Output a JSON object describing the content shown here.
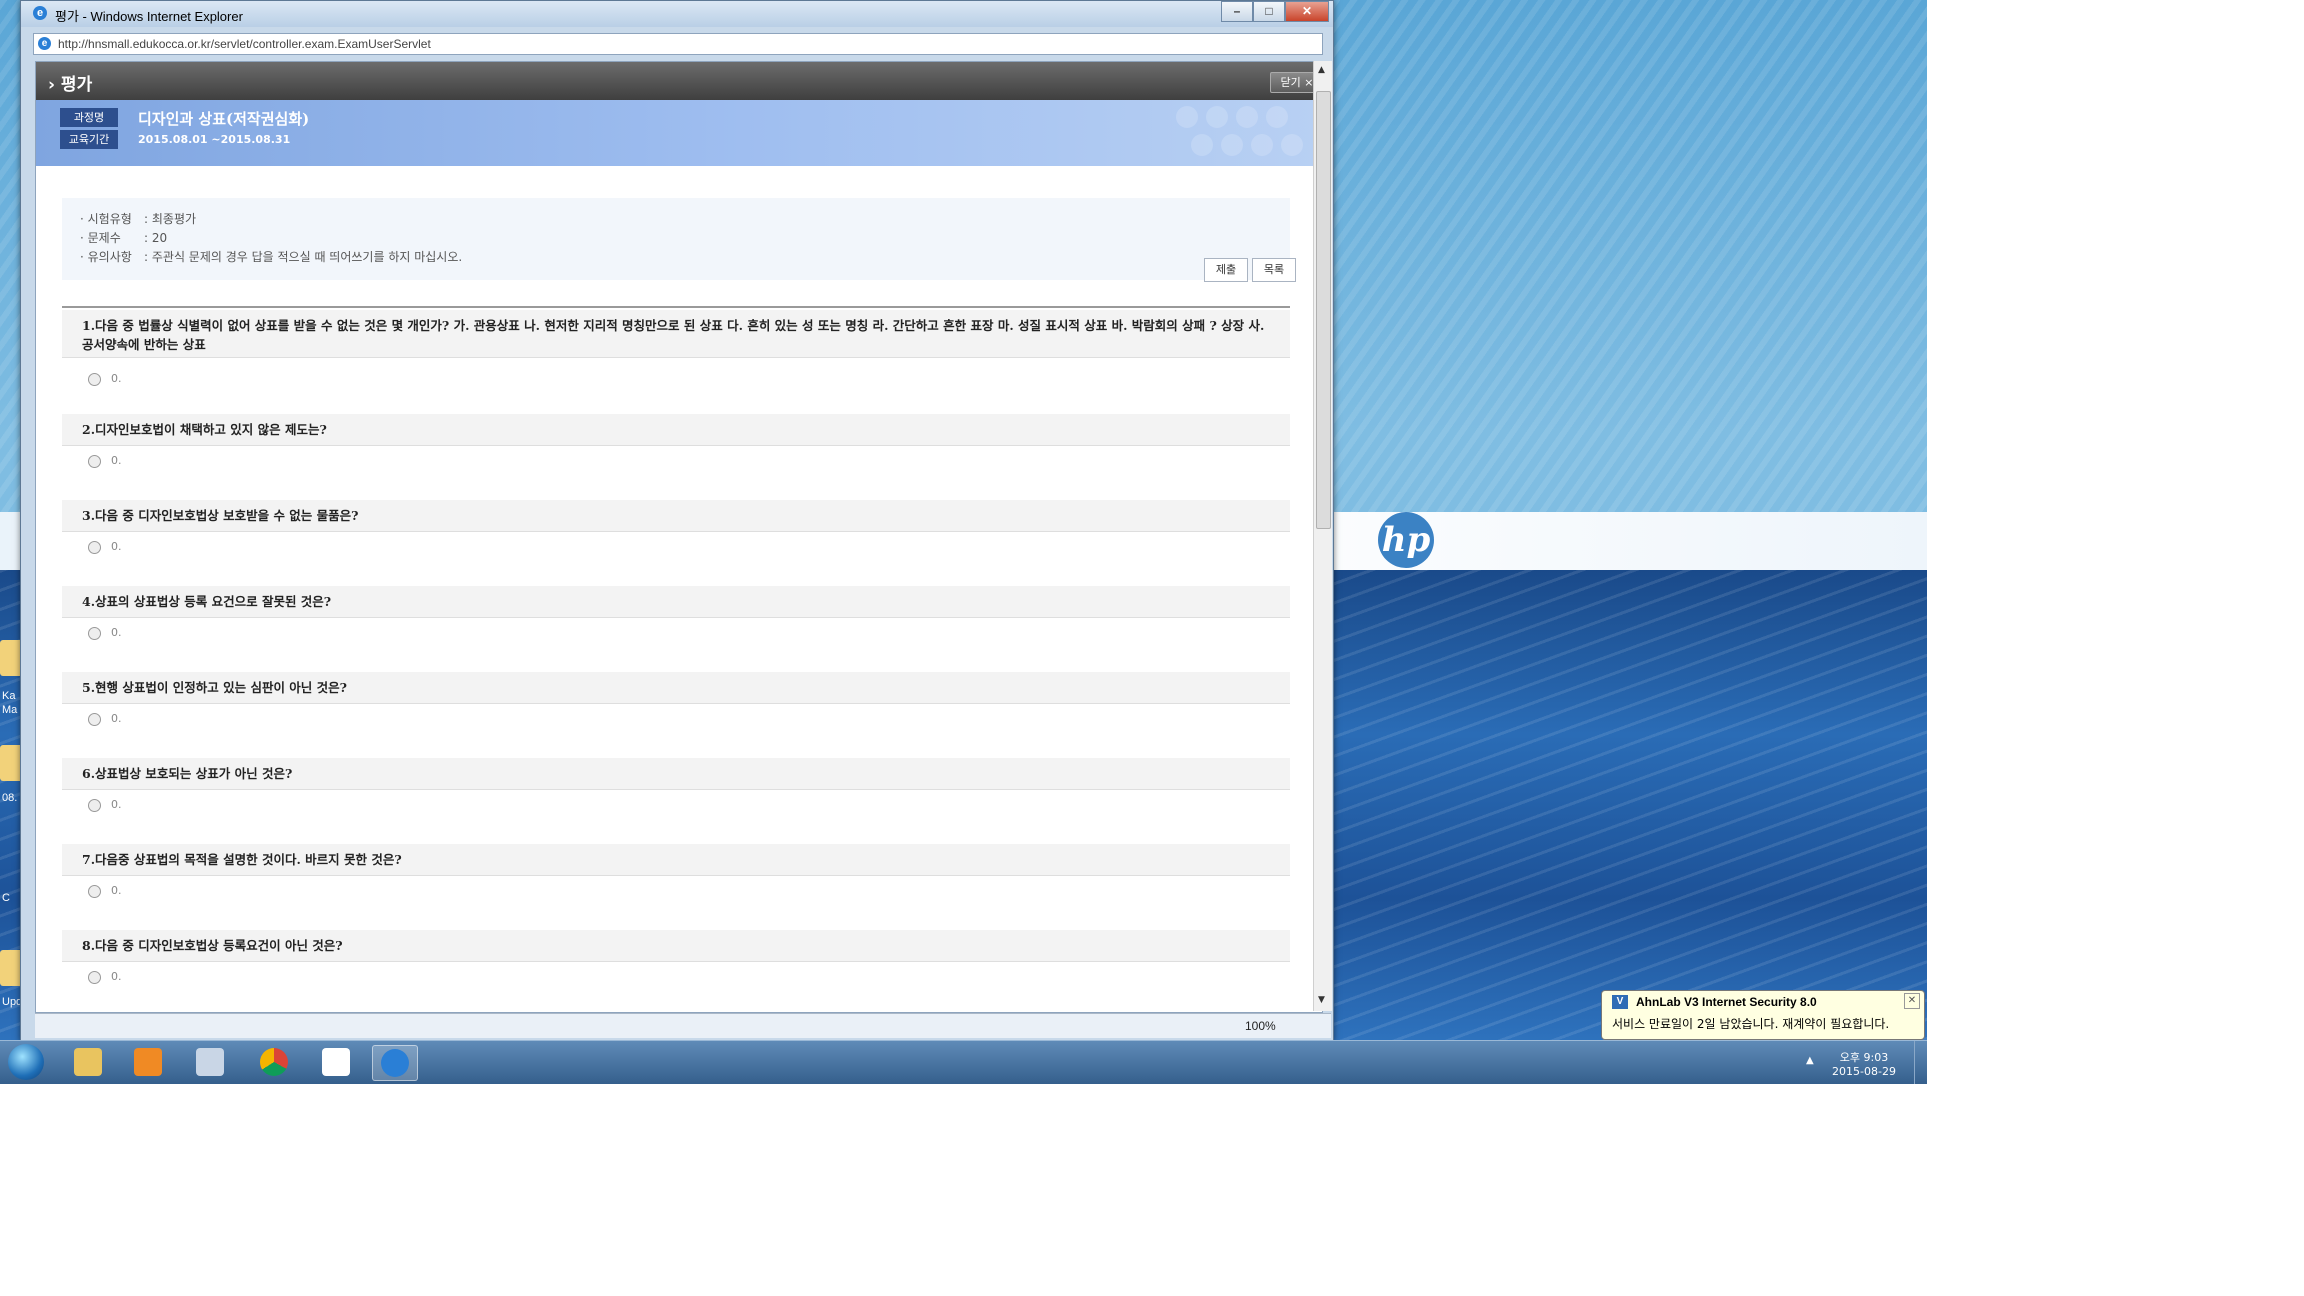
{
  "window": {
    "title": "평가 - Windows Internet Explorer",
    "address": "http://hnsmall.edukocca.or.kr/servlet/controller.exam.ExamUserServlet",
    "zoom": "100%"
  },
  "page": {
    "header_title": "› 평가",
    "close_label": "닫기 ×"
  },
  "course": {
    "name_tag": "과정명",
    "period_tag": "교육기간",
    "name": "디자인과 상표(저작권심화)",
    "period": "2015.08.01 ~2015.08.31"
  },
  "info": {
    "rows": [
      {
        "label": "· 시험유형",
        "value": ": 최종평가"
      },
      {
        "label": "· 문제수",
        "value": ": 20"
      },
      {
        "label": "· 유의사항",
        "value": ": 주관식 문제의 경우 답을 적으실 때 띄어쓰기를 하지 마십시오."
      }
    ],
    "submit_label": "제출",
    "list_label": "목록"
  },
  "questions": [
    {
      "text": "1.다음 중 법률상 식별력이 없어 상표를 받을 수 없는 것은 몇 개인가? 가. 관용상표 나. 현저한 지리적 명칭만으로 된 상표 다. 흔히 있는 성 또는 명칭 라. 간단하고 흔한 표장 마. 성질 표시적 상표 바. 박람회의 상패 ? 상장 사. 공서양속에 반하는 상표",
      "answer": "0."
    },
    {
      "text": "2.디자인보호법이 채택하고 있지 않은 제도는?",
      "answer": "0."
    },
    {
      "text": "3.다음 중 디자인보호법상 보호받을 수 없는 물품은?",
      "answer": "0."
    },
    {
      "text": "4.상표의 상표법상 등록 요건으로 잘못된 것은?",
      "answer": "0."
    },
    {
      "text": "5.현행 상표법이 인정하고 있는 심판이 아닌 것은?",
      "answer": "0."
    },
    {
      "text": "6.상표법상 보호되는 상표가 아닌 것은?",
      "answer": "0."
    },
    {
      "text": "7.다음중 상표법의 목적을 설명한 것이다. 바르지 못한 것은?",
      "answer": "0."
    },
    {
      "text": "8.다음 중 디자인보호법상 등록요건이 아닌 것은?",
      "answer": "0."
    }
  ],
  "taskbar": {
    "time": "오후 9:03",
    "date": "2015-08-29"
  },
  "notification": {
    "title": "AhnLab V3 Internet Security 8.0",
    "body": "서비스 만료일이 2일 남았습니다. 재계약이 필요합니다."
  },
  "desktop": {
    "labels": [
      "Ka",
      "Ma",
      "08.",
      "C",
      "Upd"
    ]
  },
  "colors": {
    "banner": "#8fb3ea",
    "header": "#555555",
    "tag": "#2d4f8e"
  }
}
